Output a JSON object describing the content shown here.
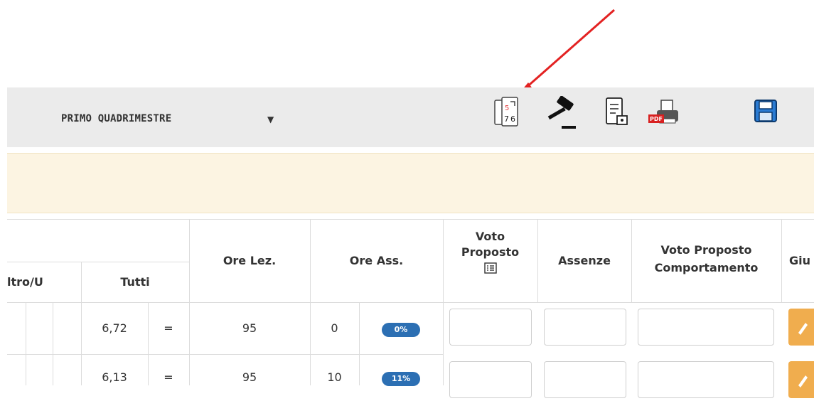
{
  "toolbar": {
    "period_label": "PRIMO QUADRIMESTRE",
    "icons": [
      "grade-sheet-icon",
      "gavel-icon",
      "document-lock-icon",
      "pdf-print-icon",
      "save-icon"
    ]
  },
  "table": {
    "headers": {
      "altro_u": "ltro/U",
      "tutti": "Tutti",
      "ore_lez": "Ore Lez.",
      "ore_ass": "Ore Ass.",
      "voto_proposto_1": "Voto",
      "voto_proposto_2": "Proposto",
      "assenze": "Assenze",
      "voto_comp_1": "Voto Proposto",
      "voto_comp_2": "Comportamento",
      "giu": "Giu"
    },
    "rows": [
      {
        "media": "6,72",
        "trend": "=",
        "ore_lez": "95",
        "ore_ass": "0",
        "perc": "0%"
      },
      {
        "media": "6,13",
        "trend": "=",
        "ore_lez": "95",
        "ore_ass": "10",
        "perc": "11%"
      }
    ]
  },
  "colors": {
    "toolbar_bg": "#ebebeb",
    "notice_bg": "#fcf4e2",
    "badge": "#2c6fb3",
    "action_button": "#f0ad4e",
    "arrow": "#e32222"
  }
}
